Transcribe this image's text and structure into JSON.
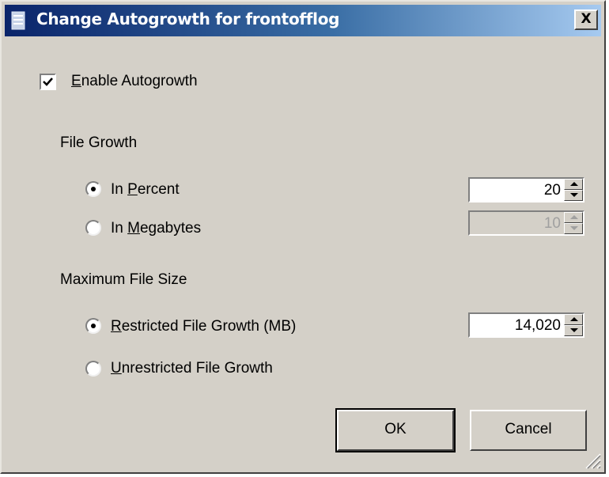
{
  "window": {
    "title": "Change Autogrowth for frontofflog",
    "close_glyph": "X",
    "icon": "database-icon"
  },
  "enable_autogrowth": {
    "label_mnemonic": "E",
    "label_rest": "nable Autogrowth",
    "checked": true
  },
  "file_growth": {
    "heading": "File Growth",
    "in_percent": {
      "prefix": "In ",
      "mnemonic": "P",
      "rest": "ercent",
      "selected": true,
      "value": "20"
    },
    "in_megabytes": {
      "prefix": "In ",
      "mnemonic": "M",
      "rest": "egabytes",
      "selected": false,
      "value": "10",
      "disabled": true
    }
  },
  "max_file_size": {
    "heading": "Maximum File Size",
    "restricted": {
      "mnemonic": "R",
      "rest": "estricted File Growth (MB)",
      "selected": true,
      "value": "14,020"
    },
    "unrestricted": {
      "mnemonic": "U",
      "rest": "nrestricted File Growth",
      "selected": false
    }
  },
  "buttons": {
    "ok_label": "OK",
    "cancel_label": "Cancel"
  }
}
